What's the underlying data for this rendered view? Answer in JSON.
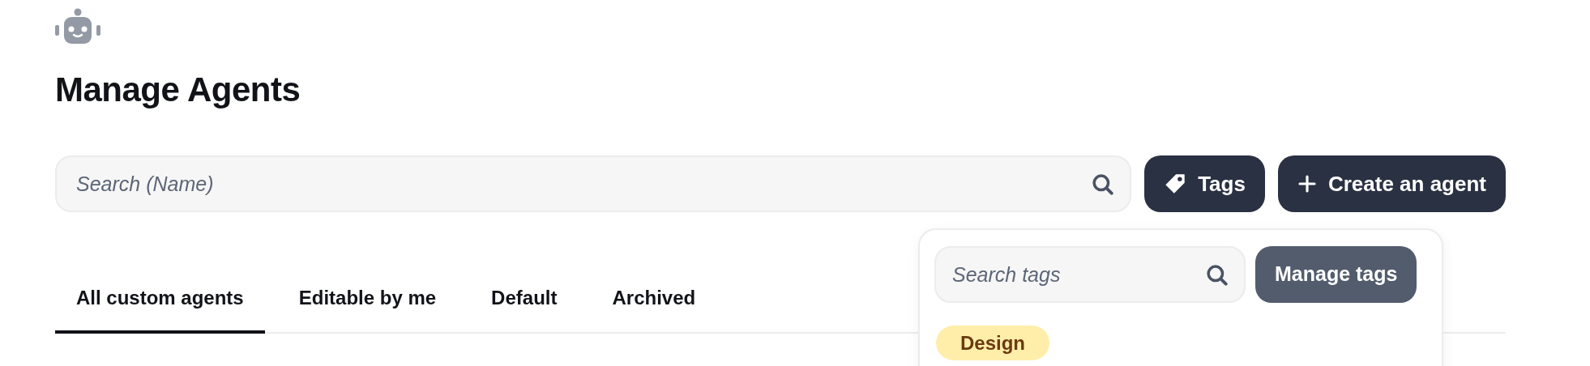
{
  "page": {
    "title": "Manage Agents"
  },
  "search": {
    "placeholder": "Search (Name)"
  },
  "buttons": [
    {
      "kind": "tags",
      "label": "Tags"
    },
    {
      "kind": "create",
      "label": "Create an agent"
    }
  ],
  "tabs": [
    {
      "label": "All custom agents",
      "selected": true
    },
    {
      "label": "Editable by me",
      "selected": false
    },
    {
      "label": "Default",
      "selected": false
    },
    {
      "label": "Archived",
      "selected": false
    }
  ],
  "tags_menu": {
    "search": {
      "placeholder": "Search tags"
    },
    "manage_button": "Manage tags",
    "tags": [
      {
        "label": "Design",
        "color": "#ffeeaa"
      }
    ]
  }
}
